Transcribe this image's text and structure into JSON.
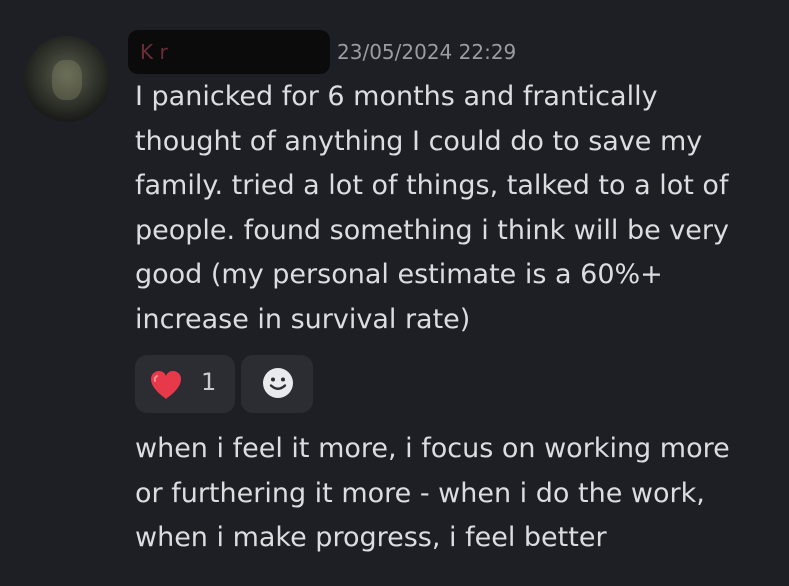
{
  "message": {
    "username": "K                    r",
    "timestamp": "23/05/2024 22:29",
    "lines": [
      "I panicked for 6 months and frantically",
      "thought of anything I could do to save my",
      "family. tried a lot of things, talked to a lot of",
      "people. found something i think will be very",
      "good (my personal estimate is a 60%+",
      "increase in survival rate)"
    ],
    "reactions": [
      {
        "icon": "heart-icon",
        "count": "1",
        "color": "#e8394a"
      }
    ],
    "add_reaction_icon": "smile-icon"
  },
  "followup": {
    "lines": [
      "when i feel it more, i focus on working more",
      "or furthering it more - when i do the work,",
      "when i make progress, i feel better"
    ]
  },
  "colors": {
    "background": "#1e1f24",
    "text": "#dcdde1",
    "timestamp": "#9a9ca3",
    "pill": "#2b2d33"
  }
}
